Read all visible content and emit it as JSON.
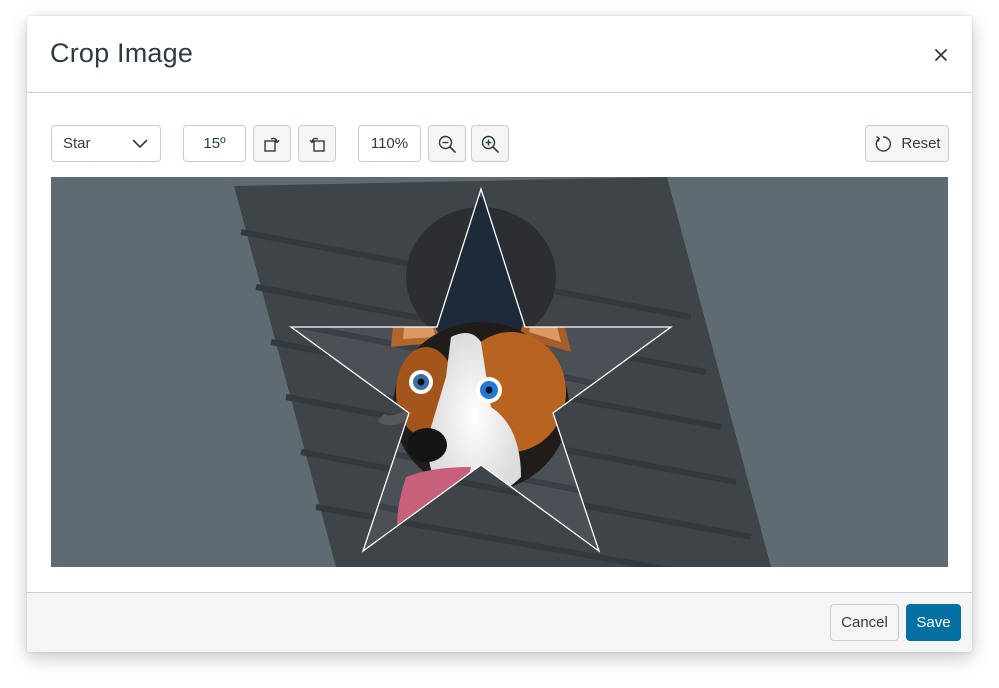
{
  "dialog": {
    "title": "Crop Image"
  },
  "toolbar": {
    "shape_select": {
      "value": "Star"
    },
    "rotation_value": "15º",
    "zoom_value": "110%",
    "reset_label": "Reset"
  },
  "footer": {
    "cancel_label": "Cancel",
    "save_label": "Save"
  },
  "colors": {
    "primary": "#0770a3",
    "text": "#2d3b45",
    "border": "#c7cdd1",
    "canvas_background": "#5f6b73"
  }
}
